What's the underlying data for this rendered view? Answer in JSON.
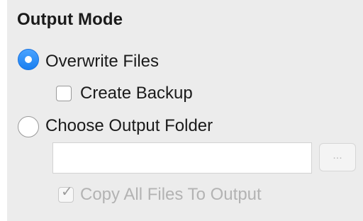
{
  "panel": {
    "title": "Output Mode",
    "options": {
      "overwrite": {
        "label": "Overwrite Files",
        "selected": true
      },
      "create_backup": {
        "label": "Create Backup",
        "checked": false
      },
      "choose_folder": {
        "label": "Choose Output Folder",
        "selected": false
      },
      "folder_path": {
        "value": "",
        "placeholder": ""
      },
      "browse_button": {
        "label": "..."
      },
      "copy_all": {
        "label": "Copy All Files To Output",
        "checked": true,
        "disabled": true
      }
    }
  },
  "colors": {
    "panel_background": "#ececec",
    "radio_selected": "#1a7ff0",
    "disabled_text": "#b3b3b3"
  }
}
